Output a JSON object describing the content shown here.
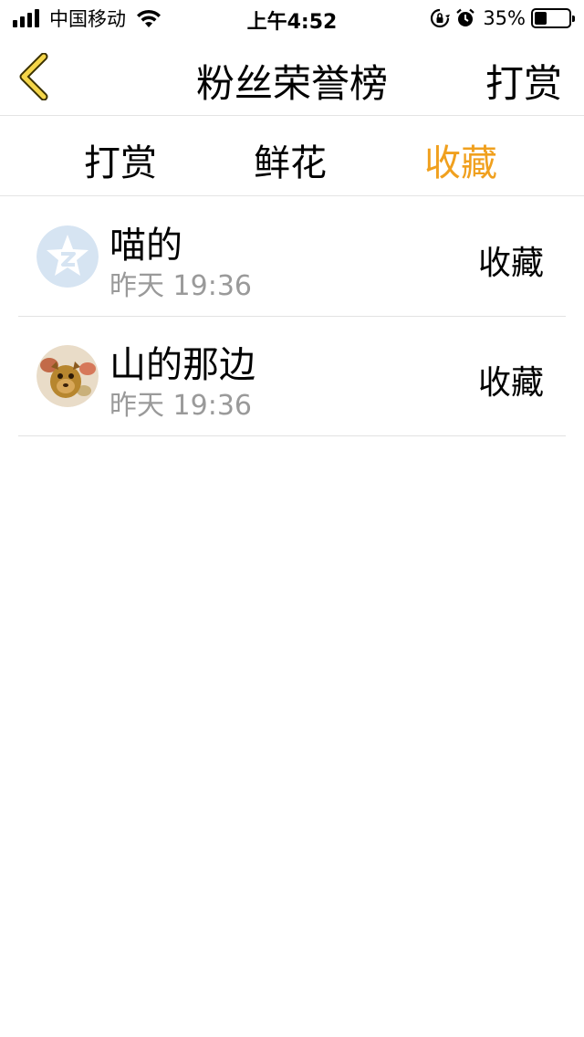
{
  "status_bar": {
    "carrier": "中国移动",
    "time": "上午4:52",
    "battery_percent": "35%",
    "battery_level": 0.35,
    "icons": [
      "signal-icon",
      "wifi-icon",
      "rotation-lock-icon",
      "alarm-icon",
      "battery-icon"
    ]
  },
  "nav": {
    "back_icon": "chevron-left-icon",
    "title": "粉丝荣誉榜",
    "right_label": "打赏"
  },
  "tabs": [
    {
      "label": "打赏",
      "active": false
    },
    {
      "label": "鲜花",
      "active": false
    },
    {
      "label": "收藏",
      "active": true
    }
  ],
  "colors": {
    "accent": "#f0a01e",
    "back_icon": "#f5d64a",
    "divider": "#e4e4e4",
    "secondary_text": "#9a9a9a"
  },
  "fans": [
    {
      "name": "喵的",
      "time": "昨天 19:36",
      "action": "收藏",
      "avatar": "default-qq-avatar-icon"
    },
    {
      "name": "山的那边",
      "time": "昨天 19:36",
      "action": "收藏",
      "avatar": "user-photo-avatar"
    }
  ]
}
